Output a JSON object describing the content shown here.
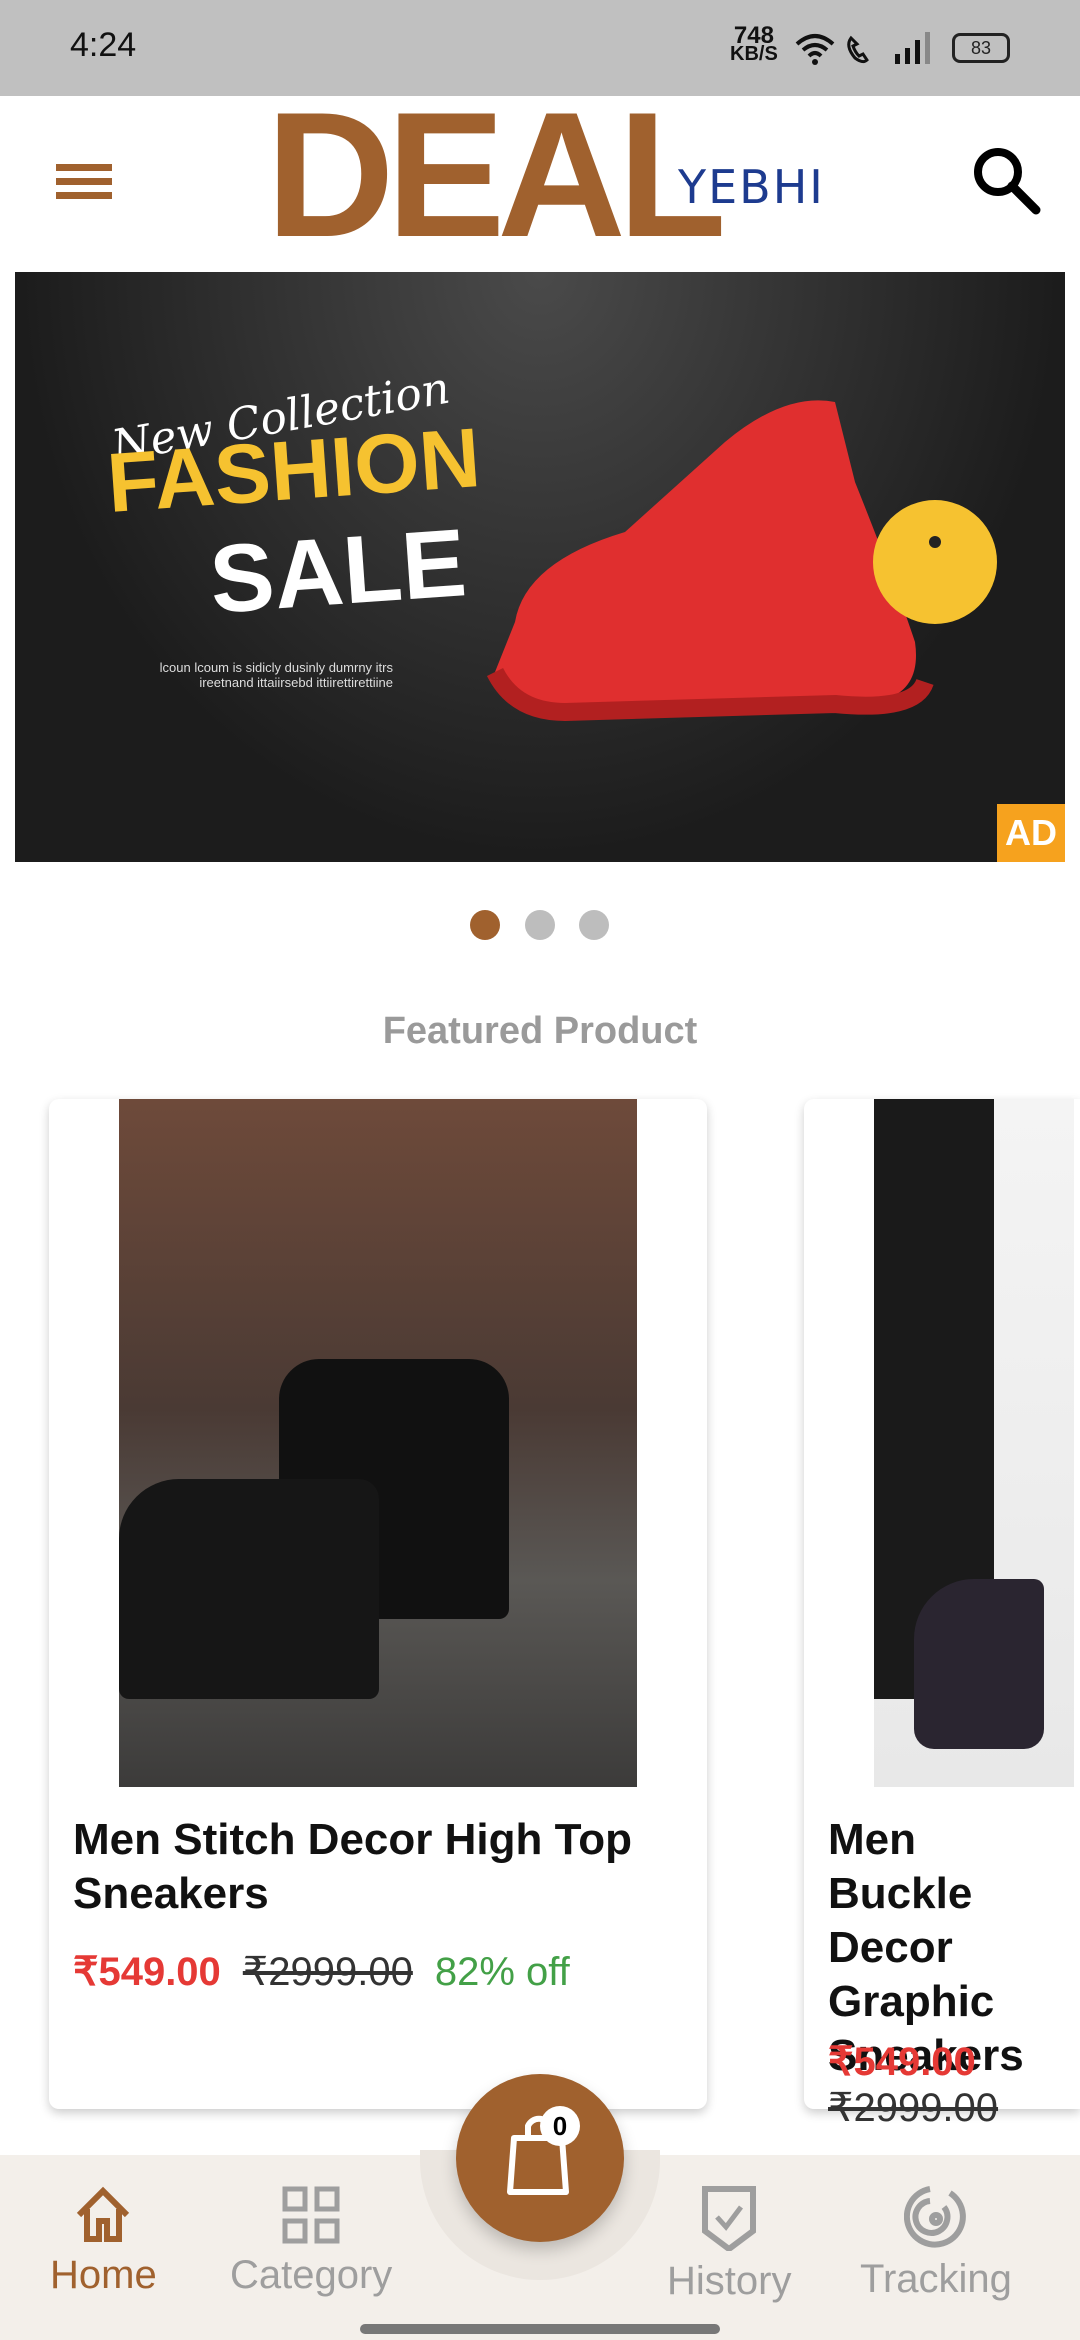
{
  "status_bar": {
    "time": "4:24",
    "net_speed": "748",
    "net_unit": "KB/S",
    "battery": "83"
  },
  "header": {
    "logo_main": "DEAL",
    "logo_sub": "YEBHI"
  },
  "banner": {
    "script_text": "New Collection",
    "headline1": "FASHION",
    "headline2": "SALE",
    "small_text": "lcoun lcoum is sidicly dusinly dumrny itrs ireetnand ittaiirsebd ittiirettirettiine",
    "ad_label": "AD",
    "active_slide": 1,
    "slide_count": 3
  },
  "featured": {
    "heading": "Featured Product"
  },
  "products": [
    {
      "title": "Men Stitch Decor High Top Sneakers",
      "price": "₹549.00",
      "mrp": "₹2999.00",
      "discount": "82% off"
    },
    {
      "title": "Men Buckle Decor Graphic Sneakers",
      "price": "₹549.00",
      "mrp": "₹2999.00"
    }
  ],
  "cart": {
    "count": "0"
  },
  "nav": [
    {
      "label": "Home",
      "icon": "home-icon",
      "active": true
    },
    {
      "label": "Category",
      "icon": "grid-icon"
    },
    {
      "label": "History",
      "icon": "shield-check-icon"
    },
    {
      "label": "Tracking",
      "icon": "radar-icon"
    }
  ],
  "colors": {
    "brand": "#a0612e",
    "price": "#e53935",
    "discount": "#43a047",
    "ad": "#f6a21e"
  }
}
